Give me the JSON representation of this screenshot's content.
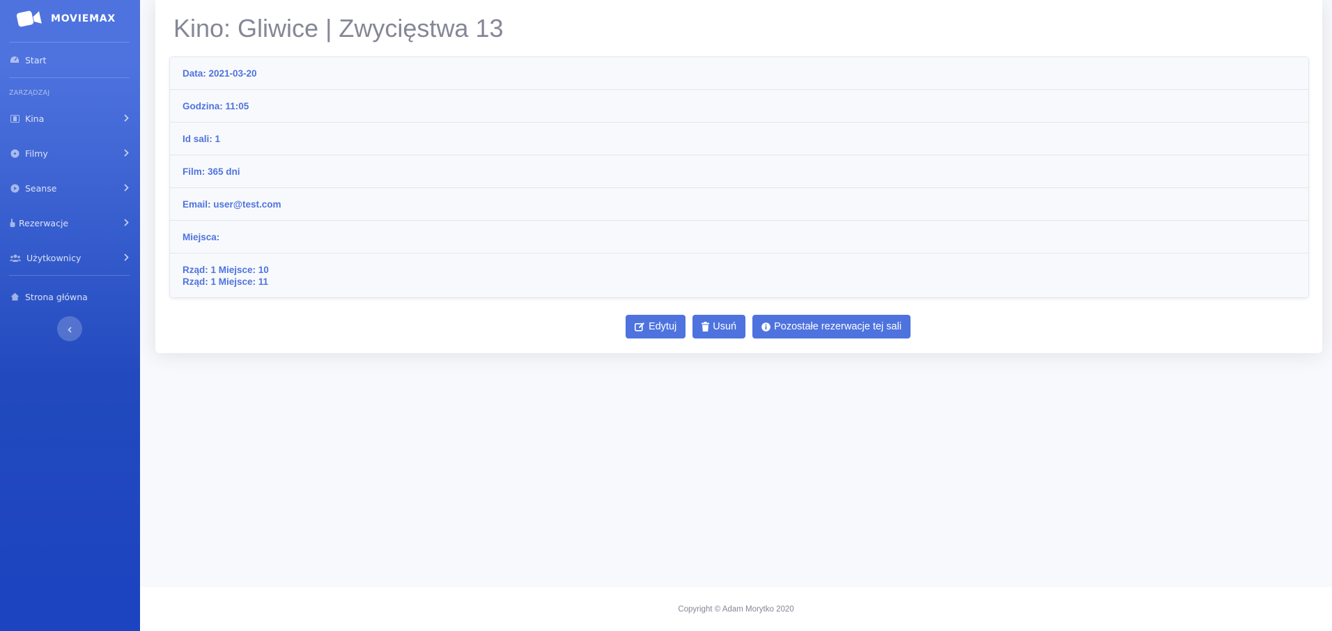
{
  "brand": {
    "name": "MOVIEMAX"
  },
  "sidebar": {
    "start": "Start",
    "heading": "ZARZĄDZAJ",
    "items": [
      {
        "label": "Kina",
        "icon": "film-icon"
      },
      {
        "label": "Filmy",
        "icon": "film-reel-icon"
      },
      {
        "label": "Seanse",
        "icon": "play-circle-icon"
      },
      {
        "label": "Rezerwacje",
        "icon": "hand-pointer-icon"
      },
      {
        "label": "Użytkownicy",
        "icon": "users-icon"
      }
    ],
    "home": "Strona główna"
  },
  "page": {
    "title": "Kino: Gliwice | Zwycięstwa 13",
    "details": {
      "date": "Data: 2021-03-20",
      "time": "Godzina: 11:05",
      "hall": "Id sali: 1",
      "film": "Film: 365 dni",
      "email": "Email: user@test.com",
      "seats_label": "Miejsca:",
      "seats": [
        "Rząd: 1 Miejsce: 10",
        "Rząd: 1 Miejsce: 11"
      ]
    },
    "buttons": {
      "edit": "Edytuj",
      "delete": "Usuń",
      "other": "Pozostałe rezerwacje tej sali"
    }
  },
  "footer": {
    "copyright": "Copyright © Adam Morytko 2020"
  },
  "colors": {
    "primary": "#4e73df",
    "sidebar_dark": "#224abe",
    "muted": "#858796"
  }
}
